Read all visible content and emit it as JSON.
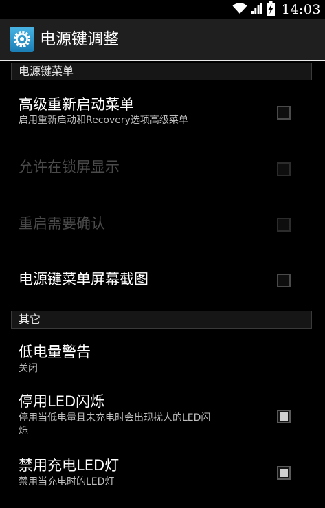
{
  "status_bar": {
    "time": "14:03",
    "icons": [
      "wifi-icon",
      "signal-icon",
      "battery-charging-icon"
    ]
  },
  "action_bar": {
    "title": "电源键调整",
    "icon": "settings-gear-icon",
    "icon_color": "#33a0d8"
  },
  "categories": {
    "power_menu": "电源键菜单",
    "other": "其它"
  },
  "preferences": {
    "advanced_reboot": {
      "title": "高级重新启动菜单",
      "summary": "启用重新启动和Recovery选项高级菜单",
      "checked": false,
      "enabled": true
    },
    "allow_on_lockscreen": {
      "title": "允许在锁屏显示",
      "checked": false,
      "enabled": false
    },
    "reboot_confirm": {
      "title": "重启需要确认",
      "checked": false,
      "enabled": false
    },
    "power_menu_screenshot": {
      "title": "电源键菜单屏幕截图",
      "checked": false,
      "enabled": true
    },
    "low_battery_warning": {
      "title": "低电量警告",
      "summary": "关闭"
    },
    "disable_led_blink": {
      "title": "停用LED闪烁",
      "summary": "停用当低电量且未充电时会出现扰人的LED闪烁",
      "checked": true,
      "enabled": true
    },
    "disable_charging_led": {
      "title": "禁用充电LED灯",
      "summary": "禁用当充电时的LED灯",
      "checked": true,
      "enabled": true
    }
  }
}
